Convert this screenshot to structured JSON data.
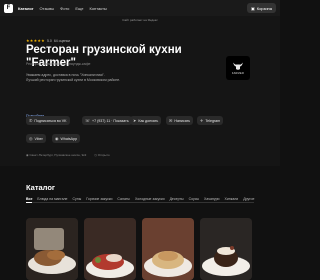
{
  "nav": {
    "logo_glyph": "F",
    "links": [
      "Каталог",
      "Отзывы",
      "Фото",
      "Еще",
      "Контакты"
    ],
    "cart_label": "Корзина"
  },
  "hero": {
    "promo": "Сайт работает на Яндекс",
    "rating": "5.0",
    "stars": "★★★★★",
    "reviews": "64 оценки",
    "title": "Ресторан грузинской кухни \"Farmer\"",
    "subtitle": "Ресторан, банкетный зал, лаундж-кафе",
    "desc_line1": "Уважаем адрес, доставка в ночь \"Хинкаличная\".",
    "desc_line2": "Лучший ресторан грузинской кухни в Московском районе.",
    "more_link": "Подробнее",
    "brand_text": "FARMER",
    "buttons": [
      {
        "icon": "vk-icon",
        "glyph": "✆",
        "label": "Подписаться во VK"
      },
      {
        "icon": "phone-icon",
        "glyph": "☏",
        "label": "+7 (937) 11 · Показать"
      },
      {
        "icon": "route-icon",
        "glyph": "➤",
        "label": "Как доехать"
      },
      {
        "icon": "message-icon",
        "glyph": "✉",
        "label": "Написать"
      },
      {
        "icon": "telegram-icon",
        "glyph": "✈",
        "label": "Telegram"
      },
      {
        "icon": "viber-icon",
        "glyph": "◎",
        "label": "Viber"
      },
      {
        "icon": "whatsapp-icon",
        "glyph": "◉",
        "label": "WhatsApp"
      }
    ],
    "address": "Санкт-Петербург, Пулковское шоссе, 9к3",
    "status": "Открыто"
  },
  "catalog": {
    "title": "Каталог",
    "categories": [
      "Все",
      "Блюда на мангале",
      "Супы",
      "Горячие закуски",
      "Салаты",
      "Холодные закуски",
      "Десерты",
      "Соусы",
      "Хачапури",
      "Хинкали",
      "Другое"
    ]
  },
  "colors": {
    "bg": "#111111",
    "star": "#f5b400",
    "link": "#8fb6ff"
  }
}
